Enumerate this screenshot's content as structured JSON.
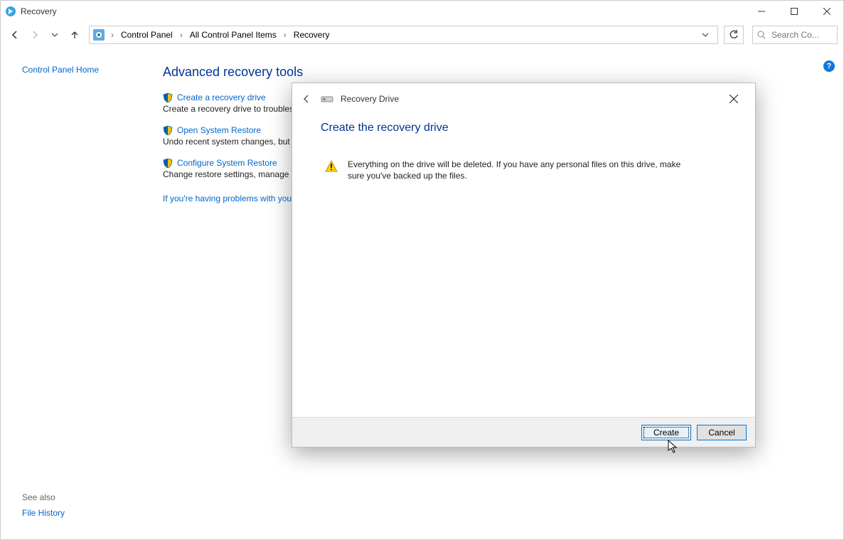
{
  "window": {
    "title": "Recovery"
  },
  "breadcrumbs": {
    "root": "Control Panel",
    "middle": "All Control Panel Items",
    "leaf": "Recovery"
  },
  "search": {
    "placeholder": "Search Co..."
  },
  "sidebar": {
    "home": "Control Panel Home",
    "seealso_label": "See also",
    "file_history": "File History"
  },
  "main": {
    "heading": "Advanced recovery tools",
    "tools": [
      {
        "link": "Create a recovery drive",
        "desc": "Create a recovery drive to troublesh"
      },
      {
        "link": "Open System Restore",
        "desc": "Undo recent system changes, but le"
      },
      {
        "link": "Configure System Restore",
        "desc": "Change restore settings, manage di"
      }
    ],
    "trouble": "If you're having problems with your"
  },
  "wizard": {
    "title": "Recovery Drive",
    "heading": "Create the recovery drive",
    "warning": "Everything on the drive will be deleted. If you have any personal files on this drive, make sure you've backed up the files.",
    "create_label": "Create",
    "cancel_label": "Cancel"
  }
}
